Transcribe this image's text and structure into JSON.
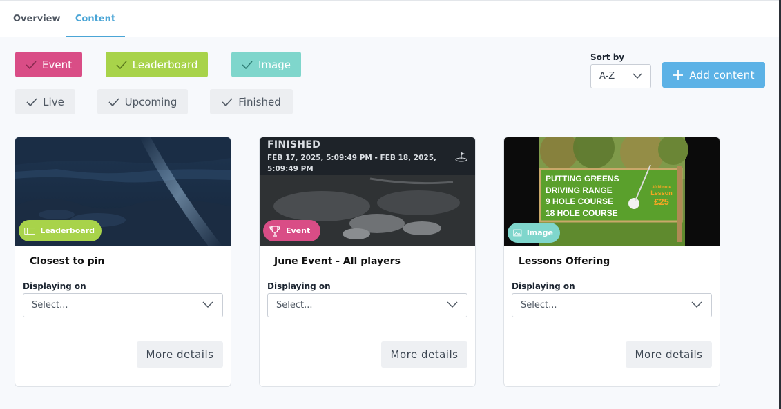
{
  "tabs": [
    {
      "label": "Overview",
      "active": false
    },
    {
      "label": "Content",
      "active": true
    }
  ],
  "type_filters": [
    {
      "label": "Event",
      "color": "#d94d86",
      "checked": true
    },
    {
      "label": "Leaderboard",
      "color": "#a8d34a",
      "checked": true
    },
    {
      "label": "Image",
      "color": "#7fd6cc",
      "checked": true
    }
  ],
  "status_filters": [
    {
      "label": "Live",
      "checked": true
    },
    {
      "label": "Upcoming",
      "checked": true
    },
    {
      "label": "Finished",
      "checked": true
    }
  ],
  "sort": {
    "label": "Sort by",
    "value": "A-Z"
  },
  "add_button": {
    "label": "Add content",
    "color": "#5cb2e6"
  },
  "cards": [
    {
      "title": "Closest to pin",
      "badge": {
        "label": "Leaderboard",
        "icon": "leaderboard-icon",
        "color": "#a8d34a"
      },
      "displaying_label": "Displaying on",
      "select_placeholder": "Select...",
      "more_label": "More details"
    },
    {
      "title": "June Event - All players",
      "status": "FINISHED",
      "dates": "FEB 17, 2025, 5:09:49 PM - FEB 18, 2025, 5:09:49 PM",
      "badge": {
        "label": "Event",
        "icon": "trophy-icon",
        "color": "#d94d86"
      },
      "displaying_label": "Displaying on",
      "select_placeholder": "Select...",
      "more_label": "More details"
    },
    {
      "title": "Lessons Offering",
      "badge": {
        "label": "Image",
        "icon": "image-icon",
        "color": "#7fd6cc"
      },
      "sign_lines": [
        "PUTTING GREENS",
        "DRIVING RANGE",
        "9 HOLE COURSE",
        "18 HOLE COURSE"
      ],
      "sign_promo": [
        "30 Minute",
        "Lesson",
        "£25"
      ],
      "displaying_label": "Displaying on",
      "select_placeholder": "Select...",
      "more_label": "More details"
    }
  ]
}
